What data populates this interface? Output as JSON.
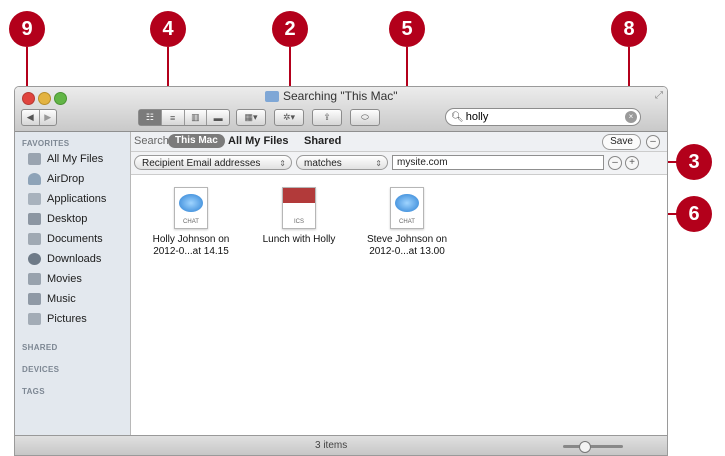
{
  "callouts": [
    "9",
    "4",
    "2",
    "5",
    "8",
    "3",
    "6"
  ],
  "window": {
    "title": "Searching \"This Mac\""
  },
  "toolbar": {
    "back": "◀",
    "forward": "▶",
    "view_icons": "☷",
    "view_list": "≡",
    "view_columns": "▥",
    "view_cover": "▬",
    "arrange": "▦▾",
    "action": "✲▾",
    "share": "⇪",
    "tag": "⬭"
  },
  "search": {
    "query": "holly"
  },
  "sidebar": {
    "favorites_label": "FAVORITES",
    "items": [
      {
        "label": "All My Files",
        "icon": "all-my-files-icon"
      },
      {
        "label": "AirDrop",
        "icon": "airdrop-icon"
      },
      {
        "label": "Applications",
        "icon": "applications-icon"
      },
      {
        "label": "Desktop",
        "icon": "desktop-icon"
      },
      {
        "label": "Documents",
        "icon": "documents-icon"
      },
      {
        "label": "Downloads",
        "icon": "downloads-icon"
      },
      {
        "label": "Movies",
        "icon": "movies-icon"
      },
      {
        "label": "Music",
        "icon": "music-icon"
      },
      {
        "label": "Pictures",
        "icon": "pictures-icon"
      }
    ],
    "shared_label": "SHARED",
    "devices_label": "DEVICES",
    "tags_label": "TAGS"
  },
  "scope": {
    "label": "Search:",
    "this_mac": "This Mac",
    "all_my_files": "All My Files",
    "shared": "Shared",
    "save": "Save",
    "minus": "–"
  },
  "criteria": {
    "attribute": "Recipient Email addresses",
    "operator": "matches",
    "value": "mysite.com",
    "minus": "–",
    "plus": "+"
  },
  "files": [
    {
      "name": "Holly Johnson on 2012-0...at 14.15",
      "kind": "CHAT"
    },
    {
      "name": "Lunch with Holly",
      "kind": "ICS"
    },
    {
      "name": "Steve Johnson on 2012-0...at 13.00",
      "kind": "CHAT"
    }
  ],
  "status": {
    "items": "3 items"
  },
  "colors": {
    "callout": "#b3001b",
    "sidebar_bg": "#e3e8ee",
    "selected_scope": "#7b7b7b"
  }
}
